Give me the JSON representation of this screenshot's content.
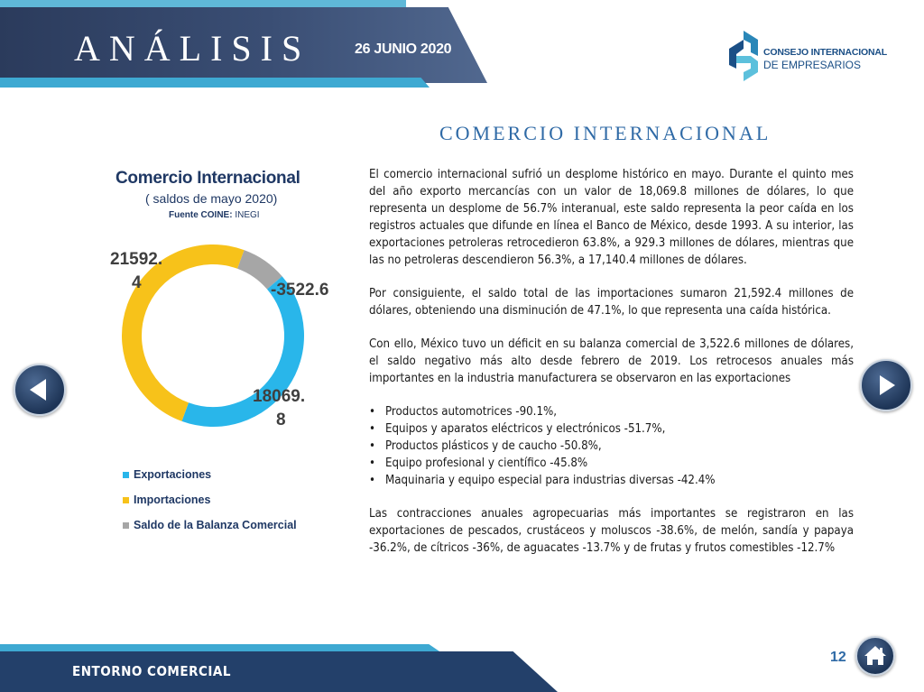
{
  "header": {
    "title": "ANÁLISIS",
    "date": "26 JUNIO 2020"
  },
  "logo": {
    "line1": "CONSEJO INTERNACIONAL",
    "line2": "DE EMPRESARIOS",
    "colors": {
      "dark": "#1b4f86",
      "mid": "#2a87b8",
      "light": "#5cc0dc"
    }
  },
  "section_title": "COMERCIO INTERNACIONAL",
  "chart": {
    "title": "Comercio Internacional",
    "subtitle": "( saldos de mayo 2020)",
    "source_label": "Fuente COINE:",
    "source_value": "INEGI",
    "labels": {
      "importaciones": [
        "21592.",
        "4"
      ],
      "exportaciones": [
        "18069.",
        "8"
      ],
      "saldo": "-3522.6"
    },
    "legend": [
      "Exportaciones",
      "Importaciones",
      "Saldo de la Balanza Comercial"
    ]
  },
  "chart_data": {
    "type": "pie",
    "title": "Comercio Internacional",
    "subtitle": "( saldos de mayo 2020)",
    "categories": [
      "Exportaciones",
      "Importaciones",
      "Saldo de la Balanza Comercial"
    ],
    "values": [
      18069.8,
      21592.4,
      -3522.6
    ],
    "colors": [
      "#29b6ea",
      "#f7c21a",
      "#a6a6a6"
    ],
    "legend_position": "bottom-left"
  },
  "body": {
    "p1": "El comercio internacional sufrió un desplome histórico en mayo. Durante el quinto mes del año exporto mercancías con un valor de 18,069.8 millones de dólares, lo que representa un desplome de 56.7% interanual, este saldo representa la peor caída en los registros actuales que difunde en línea el Banco de México, desde 1993. A su interior, las exportaciones petroleras retrocedieron 63.8%, a 929.3 millones de dólares, mientras que las no petroleras descendieron 56.3%, a 17,140.4 millones de dólares.",
    "p2": "Por consiguiente, el saldo total de las importaciones sumaron 21,592.4 millones de dólares, obteniendo una disminución de 47.1%, lo que representa una caída histórica.",
    "p3": "Con ello, México tuvo un déficit en su balanza comercial de 3,522.6 millones de dólares, el saldo negativo más alto desde febrero de 2019. Los retrocesos anuales más importantes en la industria manufacturera se observaron en las exportaciones",
    "bullets": [
      "Productos automotrices -90.1%,",
      "Equipos y aparatos eléctricos y electrónicos -51.7%,",
      "Productos plásticos y de caucho -50.8%,",
      "Equipo profesional y científico -45.8%",
      "Maquinaria y equipo especial para industrias diversas -42.4%"
    ],
    "p4": "Las contracciones anuales agropecuarias más importantes se registraron en las exportaciones de pescados, crustáceos y moluscos -38.6%, de melón, sandía y papaya -36.2%, de cítricos -36%, de aguacates -13.7% y de frutas y frutos comestibles -12.7%"
  },
  "nav": {
    "prev_icon": "arrow-left-icon",
    "next_icon": "arrow-right-icon",
    "home_icon": "home-icon"
  },
  "footer": {
    "label": "ENTORNO COMERCIAL",
    "page_number": "12"
  }
}
